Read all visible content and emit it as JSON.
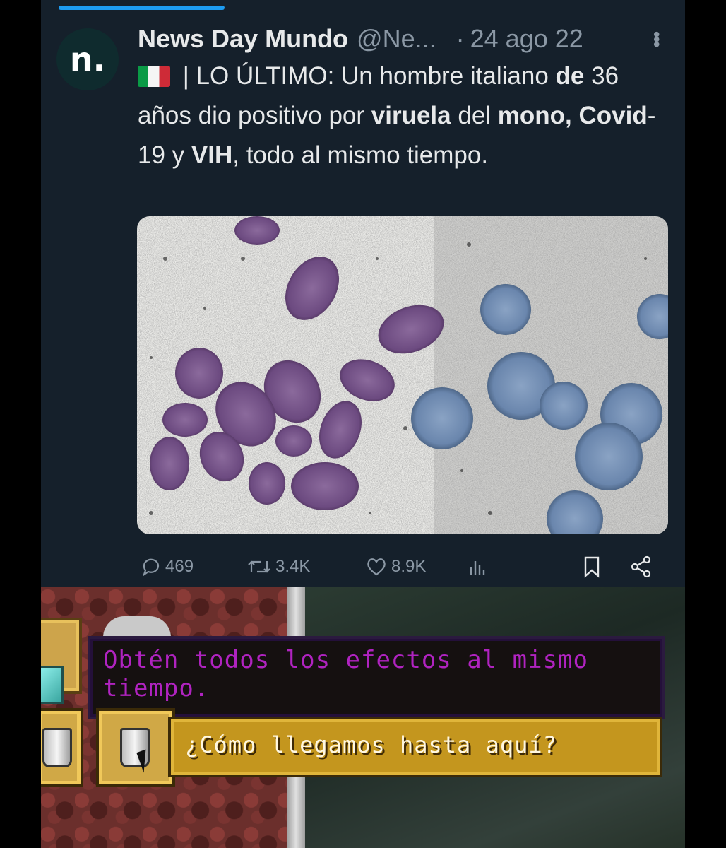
{
  "tweet": {
    "avatar_letter": "n.",
    "author_name": "News Day Mundo",
    "author_handle": "@Ne...",
    "separator": "·",
    "date": "24 ago 22",
    "more_icon": "more-vertical-icon",
    "text_segments": [
      {
        "text": " | LO ÚLTIMO: Un hombre italiano ",
        "bold": false
      },
      {
        "text": "de",
        "bold": true
      },
      {
        "text": " 36 años dio positivo por ",
        "bold": false
      },
      {
        "text": "viruela",
        "bold": true
      },
      {
        "text": " del ",
        "bold": false
      },
      {
        "text": "mono, Covid",
        "bold": true
      },
      {
        "text": "-19 y ",
        "bold": false
      },
      {
        "text": "VIH",
        "bold": true
      },
      {
        "text": ", todo al mismo tiempo.",
        "bold": false
      }
    ],
    "flag_icon": "italy-flag-icon",
    "actions": {
      "replies": "469",
      "retweets": "3.4K",
      "likes": "8.9K"
    },
    "colors": {
      "background": "#15202b",
      "accent": "#1d9bf0",
      "muted": "#8b98a5"
    }
  },
  "minecraft": {
    "description_text": "Obtén todos los efectos al mismo tiempo.",
    "title_text": "¿Cómo llegamos hasta aquí?",
    "colors": {
      "description": "#b023c0",
      "title_bar": "#c4961e"
    }
  }
}
